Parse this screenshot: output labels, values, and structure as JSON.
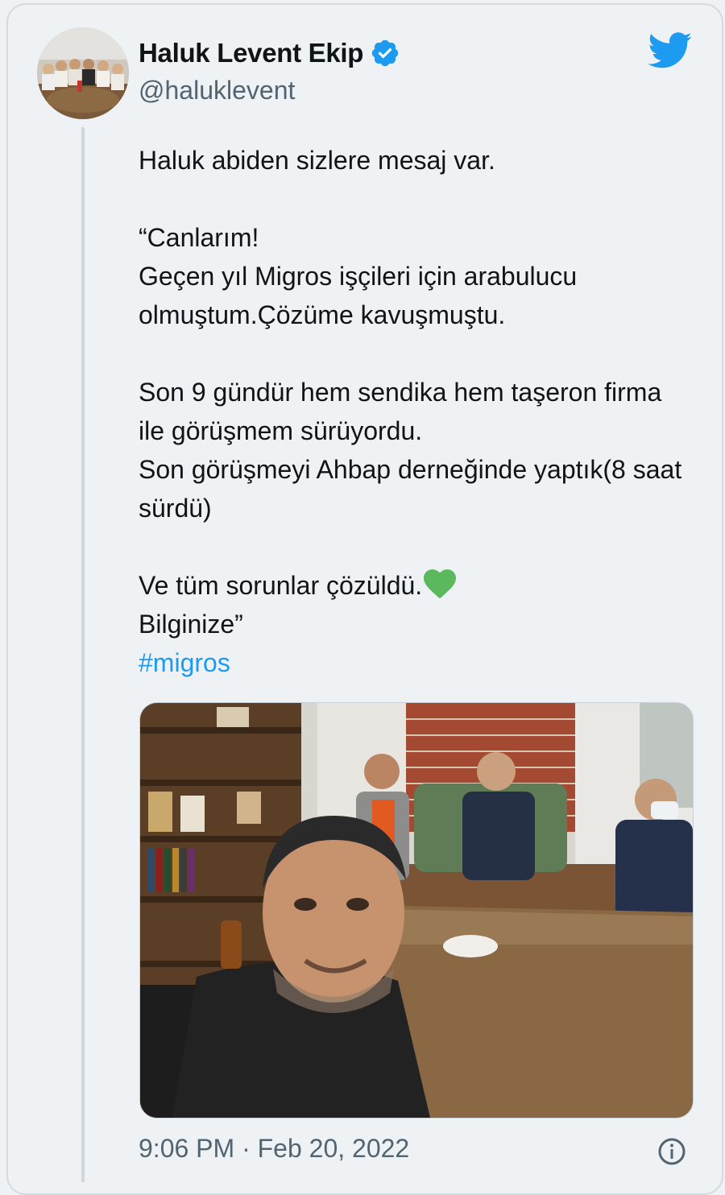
{
  "author": {
    "display_name": "Haluk Levent Ekip",
    "handle": "@haluklevent",
    "verified": true
  },
  "tweet": {
    "paragraphs": [
      {
        "lines": [
          "Haluk abiden sizlere mesaj var."
        ]
      },
      {
        "lines": [
          "“Canlarım!",
          "Geçen yıl Migros işçileri için arabulucu olmuştum.Çözüme kavuşmuştu."
        ]
      },
      {
        "lines": [
          "Son 9 gündür hem sendika hem taşeron firma ile görüşmem sürüyordu.",
          "Son görüşmeyi Ahbap derneğinde yaptık(8 saat sürdü)"
        ]
      }
    ],
    "closing_line_1": "Ve tüm sorunlar çözüldü.",
    "closing_emoji": "green-heart",
    "closing_line_2": "Bilginize”",
    "hashtag": "#migros"
  },
  "timestamp": "9:06 PM · Feb 20, 2022",
  "icons": {
    "brand": "twitter-bird-icon",
    "verified": "verified-badge-icon",
    "info": "info-icon"
  },
  "colors": {
    "background": "#eef2f5",
    "text": "#0f1419",
    "secondary_text": "#536471",
    "accent": "#1d9bf0",
    "heart": "#5cb85c"
  }
}
